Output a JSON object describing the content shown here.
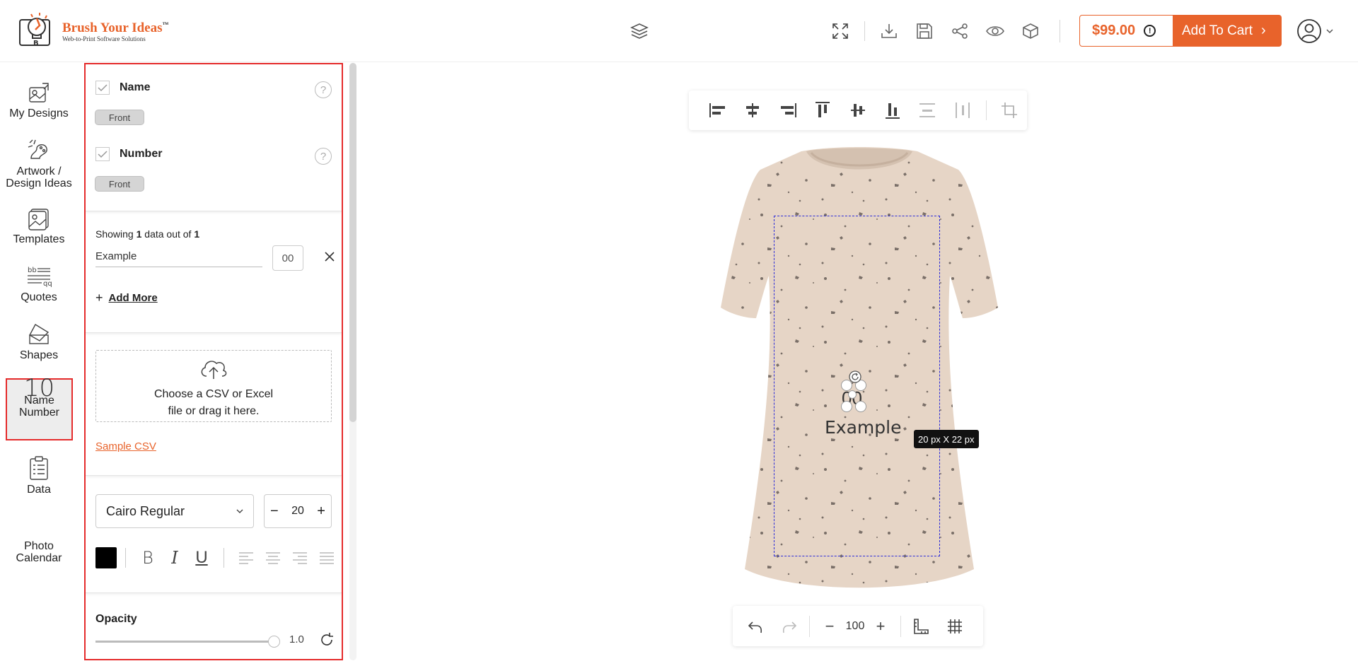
{
  "header": {
    "logo_title": "Brush Your Ideas",
    "logo_tm": "™",
    "logo_sub": "Web-to-Print Software Solutions",
    "price": "$99.00",
    "cart_label": "Add To Cart",
    "accent": "#e8632b"
  },
  "nav": {
    "my_designs": "My Designs",
    "artwork": "Artwork / Design Ideas",
    "templates": "Templates",
    "quotes": "Quotes",
    "shapes": "Shapes",
    "name_number_icon": "10",
    "name_number": "Name Number",
    "data": "Data",
    "photo_calendar": "Photo Calendar"
  },
  "panel": {
    "name_label": "Name",
    "name_side": "Front",
    "number_label": "Number",
    "number_side": "Front",
    "showing_prefix": "Showing ",
    "showing_count": "1",
    "showing_mid": " data out of ",
    "showing_total": "1",
    "row_name": "Example",
    "row_number": "00",
    "add_more": "Add More",
    "upload_line1": "Choose a CSV or Excel",
    "upload_line2": "file or drag it here.",
    "sample_csv": "Sample CSV",
    "font": "Cairo Regular",
    "font_size": "20",
    "text_color": "#000000",
    "opacity_title": "Opacity",
    "opacity_value": "1.0"
  },
  "canvas": {
    "number_text": "00",
    "name_text": "Example",
    "size_tip": "20 px X 22 px",
    "zoom": "100",
    "shirt_color": "#e6d5c6"
  }
}
